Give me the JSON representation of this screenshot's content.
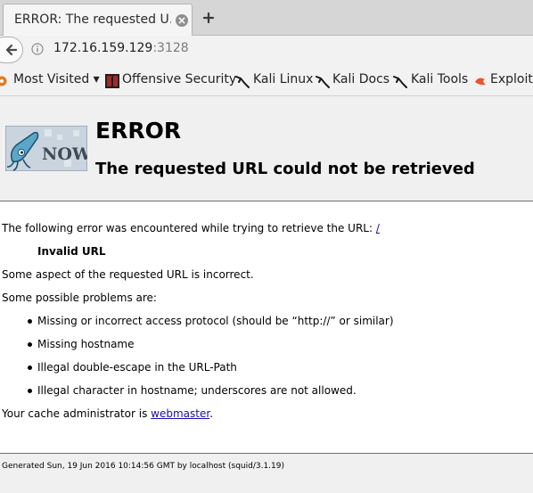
{
  "browser": {
    "tab_title": "ERROR: The requested U…",
    "url_host": "172.16.159.129",
    "url_port": ":3128",
    "bookmarks": [
      {
        "label": "Most Visited ▾",
        "icon": "gear-icon"
      },
      {
        "label": "Offensive Security",
        "icon": "offsec-icon"
      },
      {
        "label": "Kali Linux",
        "icon": "kali-dragon-icon"
      },
      {
        "label": "Kali Docs",
        "icon": "kali-dragon-icon"
      },
      {
        "label": "Kali Tools",
        "icon": "kali-dragon-icon"
      },
      {
        "label": "Exploit-",
        "icon": "exploit-db-icon"
      }
    ]
  },
  "page": {
    "logo_text": "NOW",
    "title": "ERROR",
    "subtitle": "The requested URL could not be retrieved",
    "intro": "The following error was encountered while trying to retrieve the URL: ",
    "intro_link": "/",
    "error_name": "Invalid URL",
    "description": "Some aspect of the requested URL is incorrect.",
    "problems_heading": "Some possible problems are:",
    "problems": [
      "Missing or incorrect access protocol (should be “http://” or similar)",
      "Missing hostname",
      "Illegal double-escape in the URL-Path",
      "Illegal character in hostname; underscores are not allowed."
    ],
    "admin_prefix": "Your cache administrator is ",
    "admin_link": "webmaster",
    "admin_suffix": ".",
    "footer": "Generated Sun, 19 Jun 2016 10:14:56 GMT by localhost (squid/3.1.19)"
  },
  "colors": {
    "link": "#1a0dab",
    "header_bg": "#f0f0f0",
    "tabbar_bg": "#d6d6d6"
  }
}
